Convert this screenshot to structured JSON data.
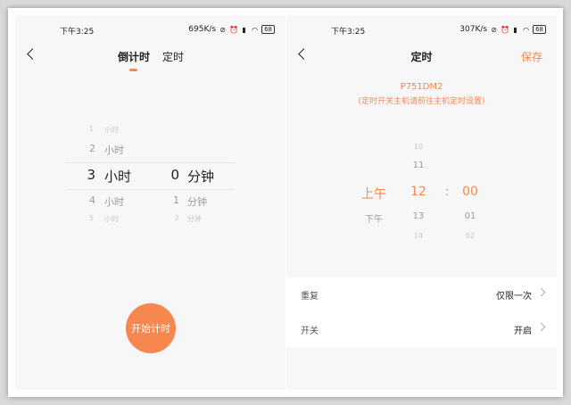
{
  "left": {
    "status": {
      "time": "下午3:25",
      "speed": "695K/s",
      "battery": "68"
    },
    "tabs": [
      {
        "label": "倒计时"
      },
      {
        "label": "定时"
      }
    ],
    "picker": {
      "hour_unit": "小时",
      "minute_unit": "分钟",
      "hours": [
        "1",
        "2",
        "3",
        "4",
        "5"
      ],
      "minutes": [
        "0",
        "1",
        "2"
      ],
      "selected_hour": "3",
      "selected_minute": "0"
    },
    "start_button": "开始计时"
  },
  "right": {
    "status": {
      "time": "下午3:25",
      "speed": "307K/s",
      "battery": "68"
    },
    "title": "定时",
    "save": "保存",
    "device": "P751DM2",
    "note": "(定时开关主机请前往主机定时设置)",
    "picker": {
      "ampm": [
        "上午",
        "下午"
      ],
      "hours": [
        "10",
        "11",
        "12",
        "13",
        "14"
      ],
      "minutes": [
        "00",
        "01",
        "02"
      ],
      "separator": ":"
    },
    "settings": [
      {
        "label": "重复",
        "value": "仅限一次"
      },
      {
        "label": "开关",
        "value": "开启"
      }
    ]
  },
  "colors": {
    "accent": "#f5874f",
    "background": "#f7f7f7"
  },
  "icons": [
    "back-icon",
    "alarm-off-icon",
    "alarm-icon",
    "signal-icon",
    "wifi-icon",
    "battery-icon",
    "chevron-right-icon"
  ]
}
